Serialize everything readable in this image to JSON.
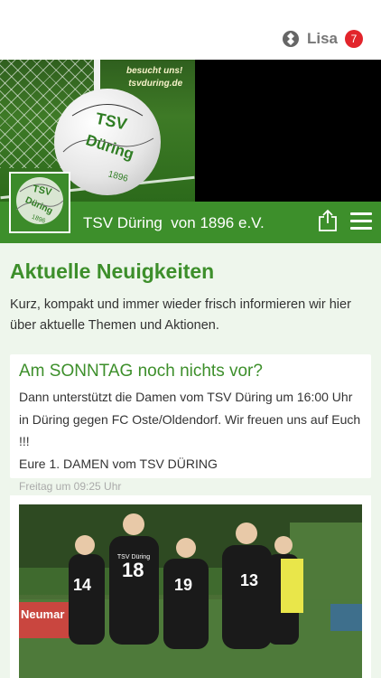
{
  "topbar": {
    "user_name": "Lisa",
    "notification_count": "7"
  },
  "hero": {
    "promo_line1": "besucht uns!",
    "promo_line2": "tsvduring.de",
    "ball_text1": "TSV",
    "ball_text2": "Düring",
    "ball_text3": "1896"
  },
  "navbar": {
    "club_name": "TSV Düring  von 1896 e.V."
  },
  "main": {
    "title": "Aktuelle Neuigkeiten",
    "description": "Kurz, kompakt und immer wieder frisch informieren wir hier über aktuelle Themen und Aktionen."
  },
  "posts": [
    {
      "title": "Am SONNTAG noch nichts vor?",
      "body_line1": "Dann unterstützt die Damen vom TSV Düring um 16:00 Uhr in Düring gegen FC Oste/Oldendorf. Wir freuen uns auf Euch !!!",
      "body_line2": "Eure 1. DAMEN vom TSV DÜRING",
      "time": "Freitag um 09:25 Uhr"
    }
  ],
  "photo_post": {
    "jersey_text": "TSV Düring",
    "numbers": [
      "14",
      "18",
      "19",
      "13"
    ],
    "banner_text": "Neumar"
  },
  "colors": {
    "brand_green": "#3d8f2b",
    "badge_red": "#e2242b",
    "background": "#eef6ec"
  }
}
